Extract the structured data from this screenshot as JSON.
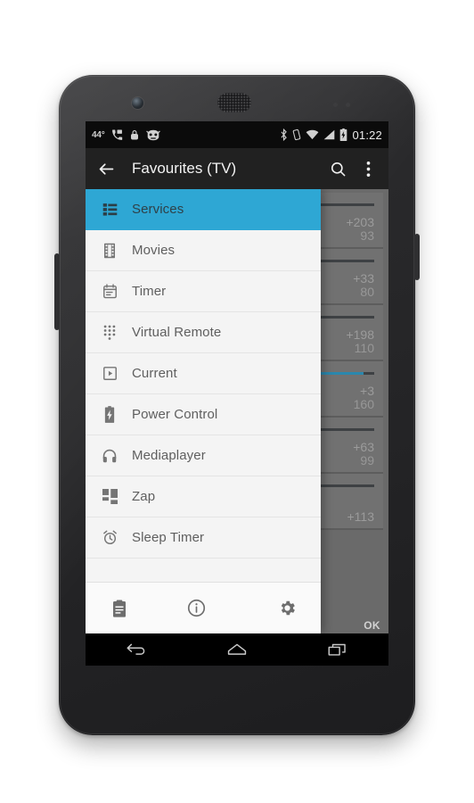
{
  "status_bar": {
    "temperature": "44°",
    "left_icons": [
      "phone-call-icon",
      "lock-icon",
      "cyanogenmod-robot-icon"
    ],
    "right_icons": [
      "bluetooth-icon",
      "vibrate-icon",
      "wifi-icon",
      "signal-icon",
      "battery-charging-icon"
    ],
    "time": "01:22"
  },
  "app_bar": {
    "back_icon": "back-arrow-icon",
    "title": "Favourites (TV)",
    "search_icon": "search-icon",
    "overflow_icon": "overflow-menu-icon"
  },
  "drawer": {
    "accent_color": "#2ea7d4",
    "items": [
      {
        "label": "Services",
        "icon": "list-icon",
        "selected": true
      },
      {
        "label": "Movies",
        "icon": "film-strip-icon",
        "selected": false
      },
      {
        "label": "Timer",
        "icon": "calendar-icon",
        "selected": false
      },
      {
        "label": "Virtual Remote",
        "icon": "dialpad-icon",
        "selected": false
      },
      {
        "label": "Current",
        "icon": "play-box-icon",
        "selected": false
      },
      {
        "label": "Power Control",
        "icon": "battery-icon",
        "selected": false
      },
      {
        "label": "Mediaplayer",
        "icon": "headphones-icon",
        "selected": false
      },
      {
        "label": "Zap",
        "icon": "grid-blocks-icon",
        "selected": false
      },
      {
        "label": "Sleep Timer",
        "icon": "alarm-clock-icon",
        "selected": false
      }
    ],
    "bottom_bar": [
      {
        "icon": "clipboard-icon",
        "name": "clipboard-button"
      },
      {
        "icon": "info-icon",
        "name": "info-button"
      },
      {
        "icon": "settings-gear-icon",
        "name": "settings-button"
      }
    ]
  },
  "background_list": {
    "ok_label": "OK",
    "rows": [
      {
        "offset": "+203",
        "duration": "93",
        "progress": 12
      },
      {
        "offset": "+33",
        "duration": "80",
        "progress": 52
      },
      {
        "offset": "+198",
        "duration": "110",
        "progress": 8
      },
      {
        "offset": "+3",
        "duration": "160",
        "progress": 96
      },
      {
        "offset": "+63",
        "duration": "99",
        "progress": 44
      },
      {
        "offset": "+113",
        "duration": "",
        "progress": 18
      }
    ]
  },
  "nav_bar": {
    "back_icon": "nav-back-icon",
    "home_icon": "nav-home-icon",
    "recents_icon": "nav-recents-icon"
  }
}
